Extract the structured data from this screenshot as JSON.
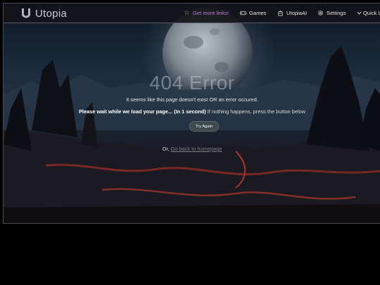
{
  "navbar": {
    "logo_text": "Utopia",
    "links": [
      {
        "label": "Get more links!",
        "icon": "star-icon"
      },
      {
        "label": "Games",
        "icon": "gamepad-icon"
      },
      {
        "label": "UtopiaAI",
        "icon": "robot-icon"
      },
      {
        "label": "Settings",
        "icon": "gear-icon"
      },
      {
        "label": "Quick Li",
        "icon": "chevron-down-icon"
      }
    ]
  },
  "error": {
    "title": "404 Error",
    "message": "It seems like this page doesn't exist OR an error occured.",
    "wait_bold": "Please wait while we load your page... (In 1 second)",
    "wait_rest": " If nothing happens, press the button below",
    "try_again_label": "Try Again",
    "or_prefix": "Or, ",
    "homepage_link": "Go back to homepage"
  },
  "colors": {
    "accent": "#b47bd0",
    "navbar_bg": "#121418",
    "button_bg": "#3c4a4e"
  }
}
